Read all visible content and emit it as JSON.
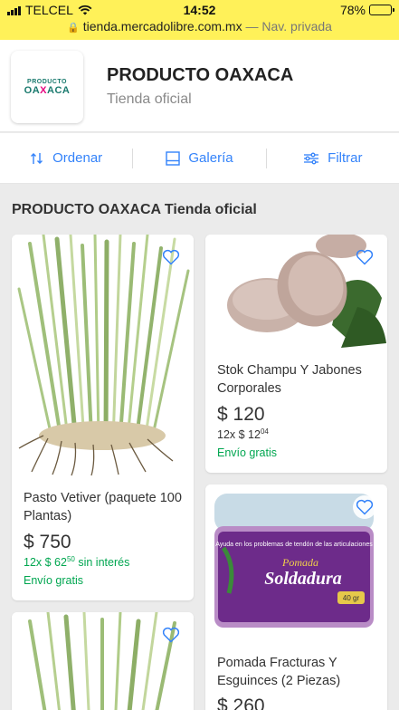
{
  "status_bar": {
    "carrier": "TELCEL",
    "time": "14:52",
    "battery": "78%",
    "battery_level": 0.78
  },
  "url_bar": {
    "domain": "tienda.mercadolibre.com.mx",
    "mode": "— Nav. privada"
  },
  "store": {
    "logo_top": "PRODUCTO",
    "logo_main_a": "OA",
    "logo_main_x": "X",
    "logo_main_b": "ACA",
    "name": "PRODUCTO OAXACA",
    "subtitle": "Tienda oficial"
  },
  "toolbar": {
    "sort_label": "Ordenar",
    "gallery_label": "Galería",
    "filter_label": "Filtrar"
  },
  "section_title": "PRODUCTO OAXACA Tienda oficial",
  "products": [
    {
      "title_line1": "Pasto Vetiver (paquete 100",
      "title_line2": "Plantas)",
      "price": "$ 750",
      "installments_prefix": "12x $ 62",
      "installments_cents": "50",
      "installments_suffix": "sin interés",
      "shipping": "Envío gratis"
    },
    {
      "title_line1": "Stok Champu Y Jabones",
      "title_line2": "Corporales",
      "price": "$ 120",
      "installments_prefix": "12x $ 12",
      "installments_cents": "04",
      "shipping": "Envío gratis"
    },
    {
      "label_text_1": "Ayuda en los problemas de tendón de las articulaciones",
      "label_brand": "Pomada",
      "label_name": "Soldadura",
      "label_weight": "40 gr",
      "title_line1": "Pomada Fracturas Y",
      "title_line2": "Esguinces (2 Piezas)",
      "price": "$ 260"
    },
    {
      "title_line1": ""
    }
  ],
  "colors": {
    "brand_yellow": "#fff159",
    "link_blue": "#3483fa",
    "success_green": "#00a650"
  }
}
